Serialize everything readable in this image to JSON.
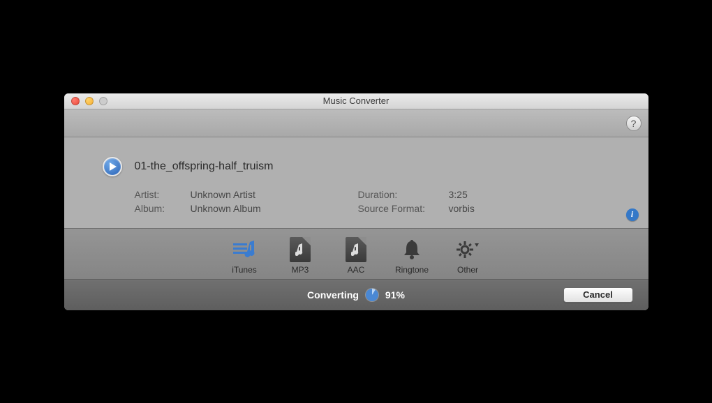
{
  "window": {
    "title": "Music Converter"
  },
  "track": {
    "name": "01-the_offspring-half_truism",
    "artist_label": "Artist:",
    "artist_value": "Unknown Artist",
    "album_label": "Album:",
    "album_value": "Unknown Album",
    "duration_label": "Duration:",
    "duration_value": "3:25",
    "source_format_label": "Source Format:",
    "source_format_value": "vorbis"
  },
  "formats": {
    "itunes": "iTunes",
    "mp3": "MP3",
    "aac": "AAC",
    "ringtone": "Ringtone",
    "other": "Other"
  },
  "progress": {
    "status": "Converting",
    "percent": "91%",
    "percent_css": "91"
  },
  "buttons": {
    "cancel": "Cancel",
    "help": "?"
  }
}
